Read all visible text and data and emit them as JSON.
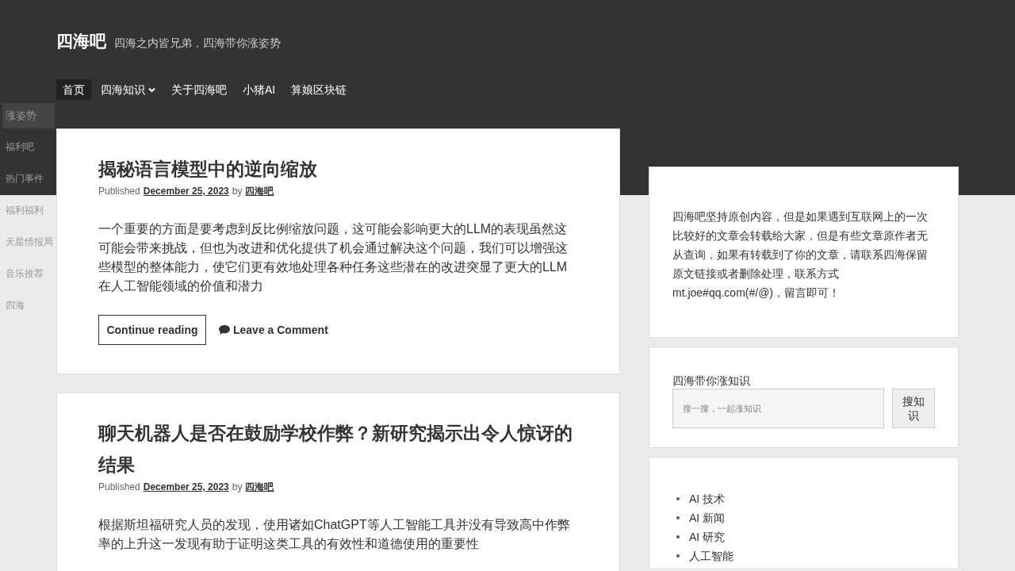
{
  "site": {
    "title": "四海吧",
    "tagline": "四海之内皆兄弟，四海带你涨姿势"
  },
  "nav": [
    {
      "label": "首页",
      "selected": true,
      "dropdown": false
    },
    {
      "label": "四海知识",
      "selected": false,
      "dropdown": true
    },
    {
      "label": "关于四海吧",
      "selected": false,
      "dropdown": false
    },
    {
      "label": "小猪AI",
      "selected": false,
      "dropdown": false
    },
    {
      "label": "算娘区块链",
      "selected": false,
      "dropdown": false
    }
  ],
  "submenu": [
    {
      "label": "涨姿势",
      "selected": true
    },
    {
      "label": "福利吧",
      "selected": false
    },
    {
      "label": "热门事件",
      "selected": false
    },
    {
      "label": "福利福利",
      "selected": false
    },
    {
      "label": "天星情报局",
      "selected": false
    },
    {
      "label": "音乐推荐",
      "selected": false
    },
    {
      "label": "四海",
      "selected": false
    }
  ],
  "posts": [
    {
      "title": "揭秘语言模型中的逆向缩放",
      "published": "Published",
      "date": "December 25, 2023",
      "by": "by",
      "author": "四海吧",
      "excerpt": "一个重要的方面是要考虑到反比例缩放问题，这可能会影响更大的LLM的表现虽然这可能会带来挑战，但也为改进和优化提供了机会通过解决这个问题，我们可以增强这些模型的整体能力，使它们更有效地处理各种任务这些潜在的改进突显了更大的LLM在人工智能领域的价值和潜力",
      "more": "Continue reading",
      "comment": "Leave a Comment"
    },
    {
      "title": "聊天机器人是否在鼓励学校作弊？新研究揭示出令人惊讶的结果",
      "published": "Published",
      "date": "December 25, 2023",
      "by": "by",
      "author": "四海吧",
      "excerpt": "根据斯坦福研究人员的发现，使用诸如ChatGPT等人工智能工具并没有导致高中作弊率的上升这一发现有助于证明这类工具的有效性和道德使用的重要性"
    }
  ],
  "sidebar": {
    "about": "四海吧坚持原创内容，但是如果遇到互联网上的一次比较好的文章会转载给大家，但是有些文章原作者无从查询，如果有转载到了你的文章，请联系四海保留原文链接或者删除处理，联系方式mt.joe#qq.com(#/@)，留言即可！",
    "search": {
      "label": "四海带你涨知识",
      "placeholder": "搜一搜，一起涨知识",
      "button": "搜知识"
    },
    "categories": [
      "AI 技术",
      "AI 新闻",
      "AI 研究",
      "人工智能"
    ]
  }
}
